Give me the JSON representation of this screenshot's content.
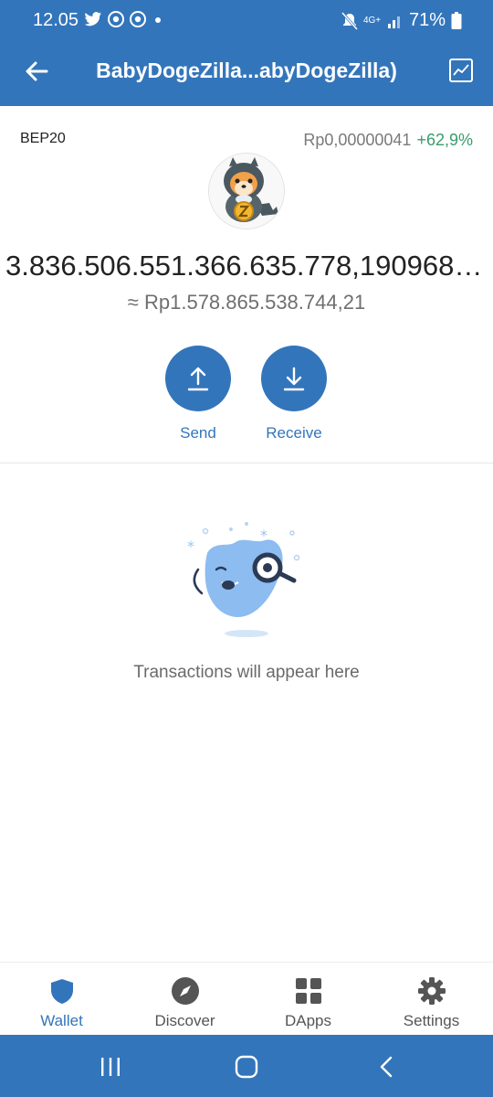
{
  "status_bar": {
    "time": "12.05",
    "battery": "71%",
    "network": "4G+",
    "icons": [
      "twitter-icon",
      "chrome-icon",
      "chrome-icon",
      "dot-icon",
      "mute-icon",
      "signal-icon",
      "battery-icon"
    ]
  },
  "header": {
    "title": "BabyDogeZilla...abyDogeZilla)"
  },
  "token": {
    "standard": "BEP20",
    "price": "Rp0,00000041",
    "change": "+62,9%",
    "balance": "3.836.506.551.366.635.778,1909686…",
    "fiat_value": "≈ Rp1.578.865.538.744,21"
  },
  "actions": {
    "send_label": "Send",
    "receive_label": "Receive"
  },
  "transactions": {
    "empty_text": "Transactions will appear here"
  },
  "bottom_nav": [
    {
      "label": "Wallet",
      "icon": "shield-icon",
      "active": true
    },
    {
      "label": "Discover",
      "icon": "compass-icon",
      "active": false
    },
    {
      "label": "DApps",
      "icon": "grid-icon",
      "active": false
    },
    {
      "label": "Settings",
      "icon": "gear-icon",
      "active": false
    }
  ],
  "colors": {
    "brand": "#3375bb",
    "positive": "#3a9c6b",
    "muted_text": "#6f6f6f"
  }
}
